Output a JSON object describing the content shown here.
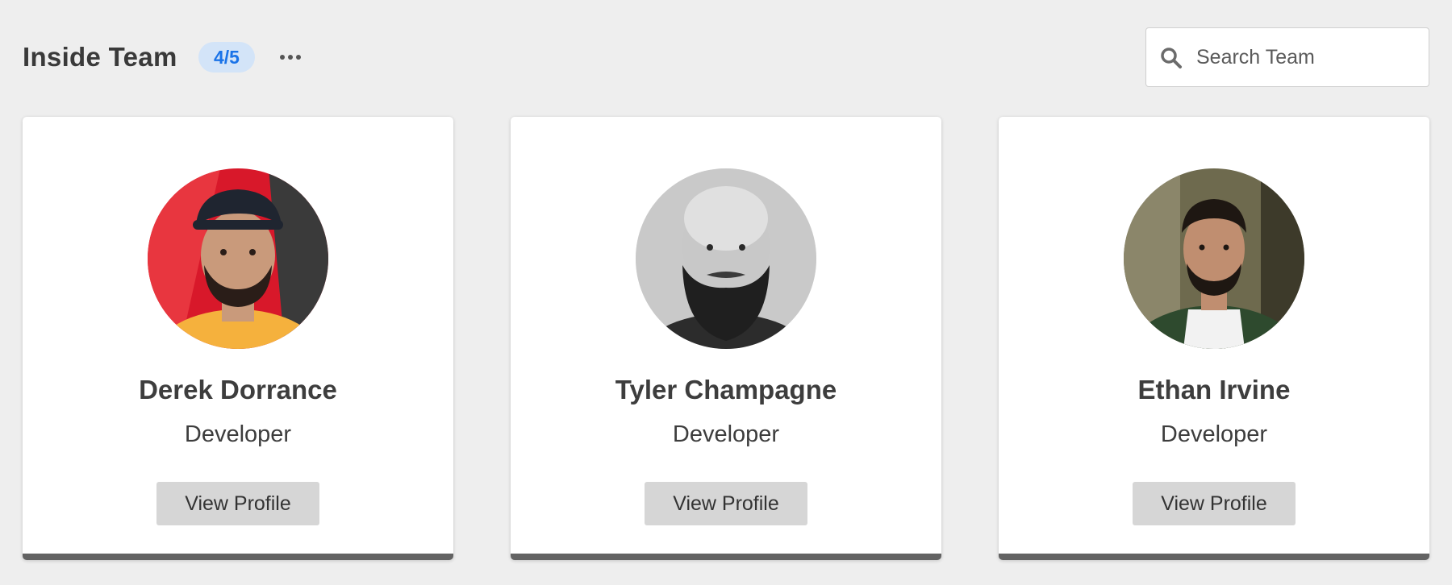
{
  "header": {
    "title": "Inside Team",
    "badge": "4/5",
    "more_icon": "more-horizontal-icon"
  },
  "search": {
    "placeholder": "Search Team",
    "value": "",
    "icon": "search-icon"
  },
  "members": [
    {
      "name": "Derek Dorrance",
      "role": "Developer",
      "button_label": "View Profile",
      "avatar_colors": {
        "background": "#d8182a",
        "shirt": "#f5b13d",
        "skin": "#c99a7b",
        "hair": "#2a1d18",
        "cap": "#1f2530"
      }
    },
    {
      "name": "Tyler Champagne",
      "role": "Developer",
      "button_label": "View Profile",
      "avatar_colors": {
        "background": "#bdbdbd",
        "shirt": "#2c2c2c",
        "skin": "#c8c8c8",
        "hair": "#1f1f1f",
        "cap": "none"
      }
    },
    {
      "name": "Ethan Irvine",
      "role": "Developer",
      "button_label": "View Profile",
      "avatar_colors": {
        "background": "#6e6a4e",
        "shirt": "#f2f2f2",
        "skin": "#c08e70",
        "hair": "#1e1712",
        "jacket": "#2e4a2e"
      }
    }
  ],
  "colors": {
    "page_background": "#eeeeee",
    "badge_background": "#d3e4f8",
    "badge_text": "#1a73e8",
    "card_accent": "#636363",
    "button_background": "#d6d6d6"
  }
}
